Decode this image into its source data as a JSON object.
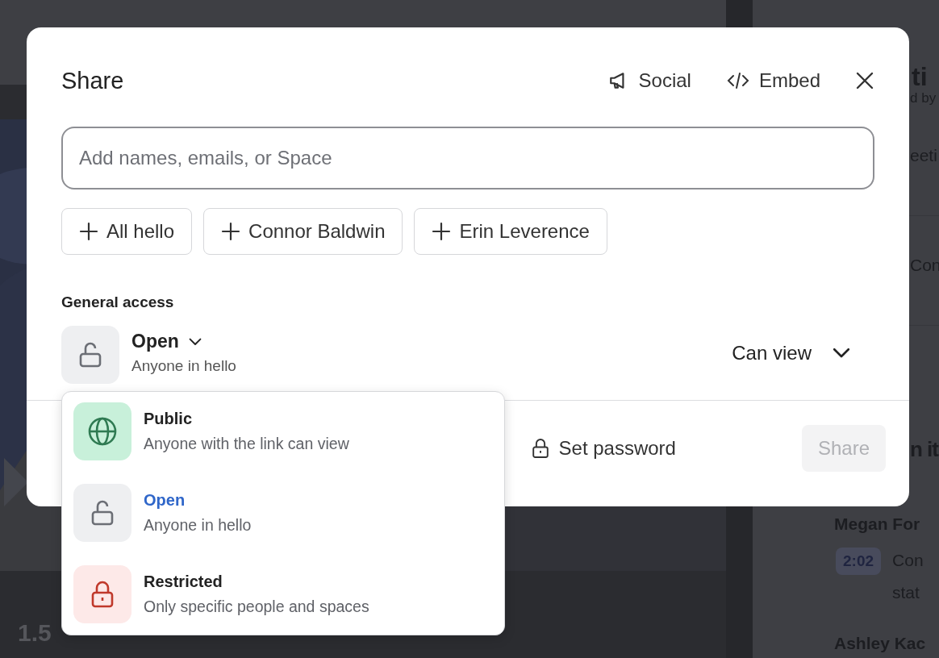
{
  "background": {
    "playback_speed": "1.5",
    "panel": [
      {
        "kind": "title",
        "text": "ti"
      },
      {
        "kind": "meta",
        "text": "d by"
      },
      {
        "kind": "row",
        "text": "eeti"
      },
      {
        "kind": "row",
        "text": "Con"
      },
      {
        "kind": "heading",
        "text": "n it"
      },
      {
        "kind": "speaker",
        "text": "Megan For"
      },
      {
        "kind": "entry",
        "time": "2:02",
        "lines": [
          "Con",
          "stat"
        ]
      },
      {
        "kind": "speaker",
        "text": "Ashley Kac"
      }
    ]
  },
  "dialog": {
    "title": "Share",
    "header_actions": [
      {
        "kind": "social",
        "label": "Social"
      },
      {
        "kind": "embed",
        "label": "Embed"
      }
    ],
    "invite_field": {
      "placeholder": "Add names, emails, or Space"
    },
    "suggestions": [
      "All hello",
      "Connor Baldwin",
      "Erin Leverence"
    ],
    "general_access": {
      "heading": "General access",
      "kind": "open",
      "level": "Open",
      "description": "Anyone in hello",
      "permission": "Can view",
      "expanded": true
    },
    "footer": {
      "password": "Set password",
      "share": {
        "label": "Share",
        "disabled": true
      }
    }
  },
  "access_menu": [
    {
      "kind": "public",
      "title": "Public",
      "description": "Anyone with the link can view",
      "selected": false
    },
    {
      "kind": "open",
      "title": "Open",
      "description": "Anyone in hello",
      "selected": true
    },
    {
      "kind": "restricted",
      "title": "Restricted",
      "description": "Only specific people and spaces",
      "selected": false
    }
  ]
}
